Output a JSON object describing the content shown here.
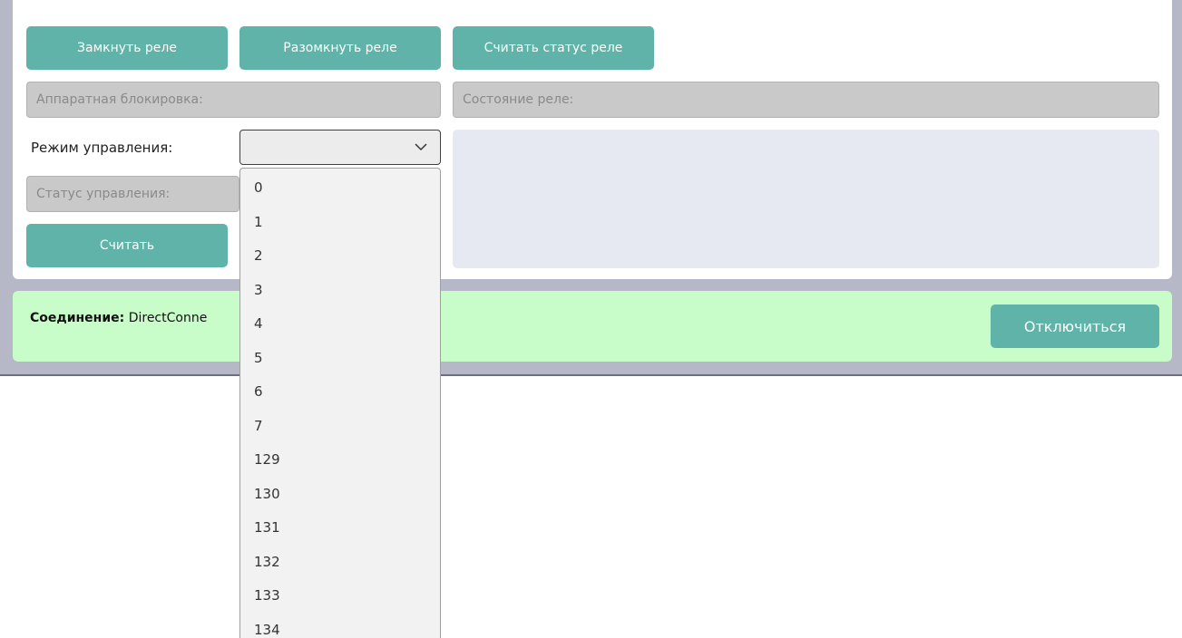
{
  "relay": {
    "close_label": "Замкнуть реле",
    "open_label": "Разомкнуть реле",
    "read_status_label": "Считать статус реле",
    "hw_lock_placeholder": "Аппаратная блокировка:",
    "state_placeholder": "Состояние реле:"
  },
  "control": {
    "mode_label": "Режим управления:",
    "mode_value": "",
    "status_placeholder": "Статус управления:",
    "read_label": "Считать",
    "mode_options": [
      "0",
      "1",
      "2",
      "3",
      "4",
      "5",
      "6",
      "7",
      "129",
      "130",
      "131",
      "132",
      "133",
      "134"
    ]
  },
  "connection": {
    "label": "Соединение:",
    "value": "DirectConne",
    "disconnect_label": "Отключиться"
  },
  "icons": {
    "dropdown": "chevron-down-icon"
  },
  "colors": {
    "button": "#5fb3a8",
    "connection_bg": "#c8fcc8",
    "frame": "#b6b8c8"
  }
}
